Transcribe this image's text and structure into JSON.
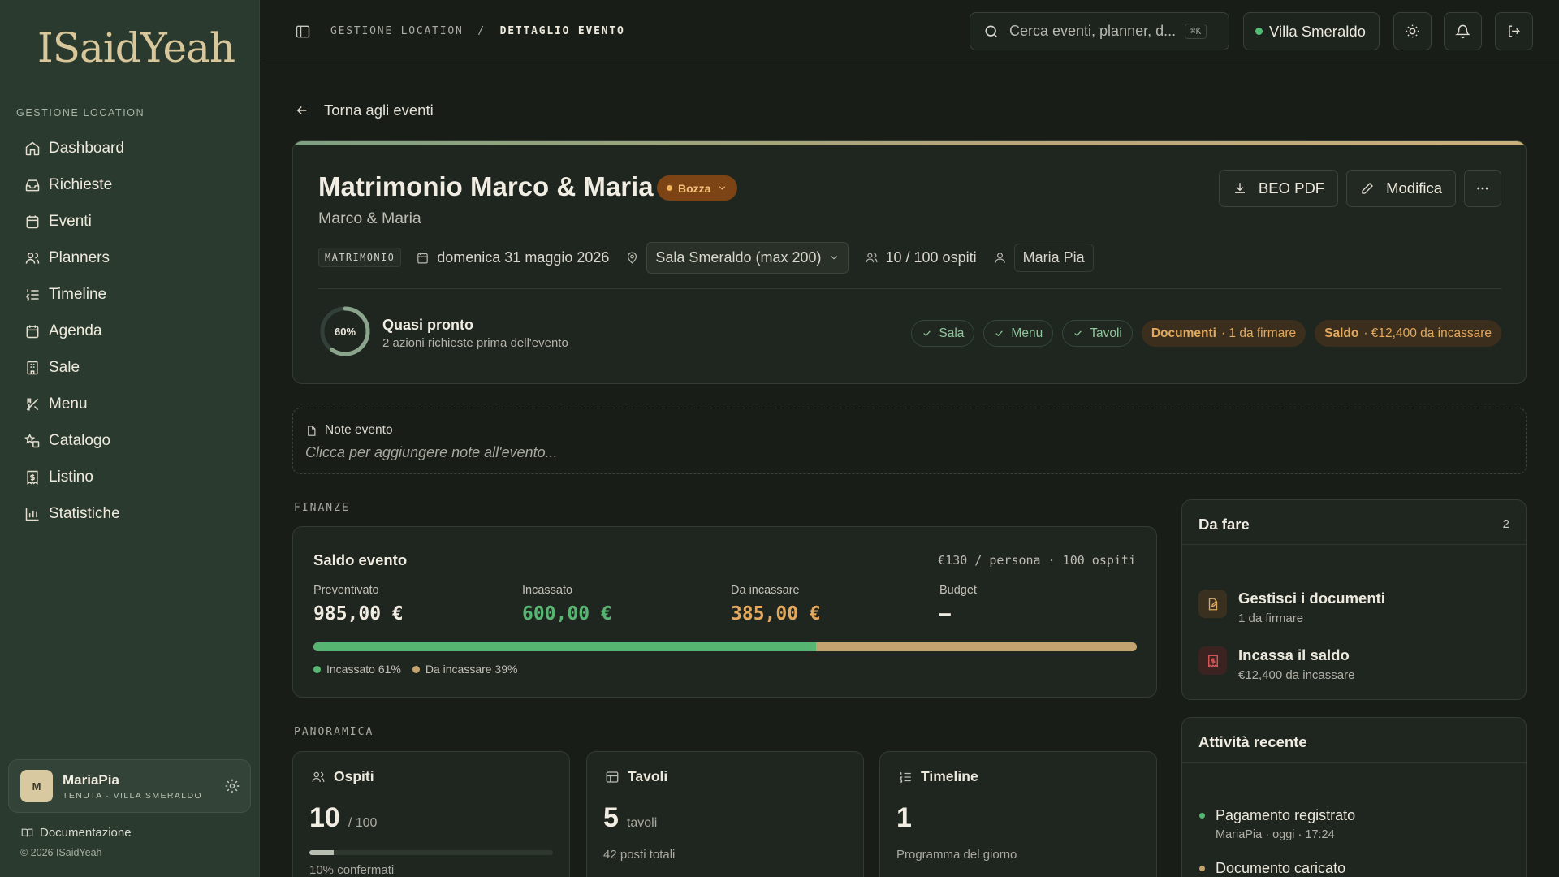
{
  "brand": {
    "logo_text": "ISaidYeah"
  },
  "sidebar": {
    "section_title": "GESTIONE LOCATION",
    "items": [
      {
        "label": "Dashboard",
        "icon": "home-icon"
      },
      {
        "label": "Richieste",
        "icon": "inbox-icon"
      },
      {
        "label": "Eventi",
        "icon": "calendar-icon"
      },
      {
        "label": "Planners",
        "icon": "users-icon"
      },
      {
        "label": "Timeline",
        "icon": "list-ordered-icon"
      },
      {
        "label": "Agenda",
        "icon": "calendar-days-icon"
      },
      {
        "label": "Sale",
        "icon": "building-icon"
      },
      {
        "label": "Menu",
        "icon": "utensils-icon"
      },
      {
        "label": "Catalogo",
        "icon": "shapes-icon"
      },
      {
        "label": "Listino",
        "icon": "receipt-icon"
      },
      {
        "label": "Statistiche",
        "icon": "bar-chart-icon"
      }
    ],
    "user": {
      "initial": "M",
      "name": "MariaPia",
      "subtitle": "TENUTA · VILLA SMERALDO"
    },
    "docs_label": "Documentazione",
    "copyright": "© 2026 ISaidYeah"
  },
  "topbar": {
    "breadcrumb_root": "GESTIONE LOCATION",
    "breadcrumb_sep": "/",
    "breadcrumb_current": "DETTAGLIO EVENTO",
    "search_placeholder": "Cerca eventi, planner, d...",
    "search_shortcut": "⌘K",
    "venue": "Villa Smeraldo",
    "venue_status_color": "#4fbf74"
  },
  "back_label": "Torna agli eventi",
  "event": {
    "title": "Matrimonio Marco & Maria",
    "status": "Bozza",
    "couple": "Marco & Maria",
    "type_tag": "MATRIMONIO",
    "date": "domenica 31 maggio 2026",
    "room": "Sala Smeraldo (max 200)",
    "guests": "10 / 100 ospiti",
    "planner": "Maria Pia",
    "actions": {
      "pdf": "BEO PDF",
      "edit": "Modifica"
    },
    "readiness": {
      "percent_label": "60%",
      "percent_value": 60,
      "title": "Quasi pronto",
      "subtitle": "2 azioni richieste prima dell'evento"
    },
    "checks": [
      {
        "label": "Sala"
      },
      {
        "label": "Menu"
      },
      {
        "label": "Tavoli"
      }
    ],
    "pending": [
      {
        "label": "Documenti",
        "detail": "· 1 da firmare"
      },
      {
        "label": "Saldo",
        "detail": "· €12,400 da incassare"
      }
    ]
  },
  "notes": {
    "title": "Note evento",
    "placeholder": "Clicca per aggiungere note all'evento..."
  },
  "finance": {
    "section": "FINANZE",
    "title": "Saldo evento",
    "per_person": "€130 / persona · 100 ospiti",
    "kpis": [
      {
        "label": "Preventivato",
        "value": "985,00 €",
        "color": "#f0ece1"
      },
      {
        "label": "Incassato",
        "value": "600,00 €",
        "color": "#57b572"
      },
      {
        "label": "Da incassare",
        "value": "385,00 €",
        "color": "#e3a85c"
      },
      {
        "label": "Budget",
        "value": "—",
        "color": "#f0ece1"
      }
    ],
    "collected_percent": 61,
    "legend": [
      {
        "label": "Incassato 61%",
        "color": "#57b572"
      },
      {
        "label": "Da incassare 39%",
        "color": "#c3a36f"
      }
    ]
  },
  "overview": {
    "section": "PANORAMICA",
    "cards": [
      {
        "title": "Ospiti",
        "icon": "users-icon",
        "value": "10",
        "unit": "/ 100",
        "sub": "10% confermati",
        "progress": 10
      },
      {
        "title": "Tavoli",
        "icon": "table-icon",
        "value": "5",
        "unit": "tavoli",
        "sub": "42 posti totali"
      },
      {
        "title": "Timeline",
        "icon": "list-ordered-icon",
        "value": "1",
        "unit": "",
        "sub": "Programma del giorno"
      }
    ]
  },
  "todo": {
    "title": "Da fare",
    "count": "2",
    "items": [
      {
        "title": "Gestisci i documenti",
        "sub": "1 da firmare"
      },
      {
        "title": "Incassa il saldo",
        "sub": "€12,400 da incassare"
      }
    ]
  },
  "activity": {
    "title": "Attività recente",
    "items": [
      {
        "title": "Pagamento registrato",
        "sub": "MariaPia · oggi · 17:24",
        "color": "#57b572"
      },
      {
        "title": "Documento caricato",
        "sub": "",
        "color": "#c3a36f"
      }
    ]
  }
}
